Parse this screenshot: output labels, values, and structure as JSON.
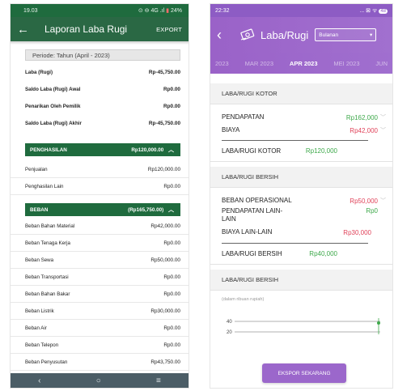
{
  "left": {
    "status_time": "19.03",
    "status_icons": "⊙ ⊖ 4G .ıl",
    "status_battery": "24%",
    "title": "Laporan Laba Rugi",
    "export_label": "EXPORT",
    "period": "Periode: Tahun (April - 2023)",
    "summary": [
      {
        "label": "Laba (Rugi)",
        "value": "Rp-45,750.00"
      },
      {
        "label": "Saldo Laba (Rugi) Awal",
        "value": "Rp0.00"
      },
      {
        "label": "Penarikan Oleh Pemilik",
        "value": "Rp0.00"
      },
      {
        "label": "Saldo Laba (Rugi) Akhir",
        "value": "Rp-45,750.00"
      }
    ],
    "income": {
      "label": "PENGHASILAN",
      "total": "Rp120,000.00",
      "items": [
        {
          "label": "Penjualan",
          "value": "Rp120,000.00"
        },
        {
          "label": "Penghasilan Lain",
          "value": "Rp0.00"
        }
      ]
    },
    "expense": {
      "label": "BEBAN",
      "total": "(Rp165,750.00)",
      "items": [
        {
          "label": "Beban Bahan Material",
          "value": "Rp42,000.00"
        },
        {
          "label": "Beban Tenaga Kerja",
          "value": "Rp0.00"
        },
        {
          "label": "Beban Sewa",
          "value": "Rp50,000.00"
        },
        {
          "label": "Beban Transportasi",
          "value": "Rp0.00"
        },
        {
          "label": "Beban Bahan Bakar",
          "value": "Rp0.00"
        },
        {
          "label": "Beban Listrik",
          "value": "Rp30,000.00"
        },
        {
          "label": "Beban Air",
          "value": "Rp0.00"
        },
        {
          "label": "Beban Telepon",
          "value": "Rp0.00"
        },
        {
          "label": "Beban Penyusutan",
          "value": "Rp43,750.00"
        }
      ]
    },
    "nav": {
      "back": "‹",
      "home": "○",
      "menu": "≡"
    },
    "icons": {
      "back": "arrow-left-icon",
      "chevron": "chevron-up-icon"
    },
    "colors": {
      "header": "#2a6844",
      "section": "#1f6b3e"
    }
  },
  "right": {
    "status_time": "22:32",
    "status_icons": "... ⊠ ᯤ",
    "status_battery": "48",
    "title": "Laba/Rugi",
    "select_value": "Bulanan",
    "tabs": [
      {
        "label": "2023",
        "active": false
      },
      {
        "label": "MAR 2023",
        "active": false
      },
      {
        "label": "APR 2023",
        "active": true
      },
      {
        "label": "MEI 2023",
        "active": false
      },
      {
        "label": "JUN",
        "active": false
      }
    ],
    "gross": {
      "header": "LABA/RUGI KOTOR",
      "income_label": "PENDAPATAN",
      "income_value": "Rp162,000",
      "cost_label": "BIAYA",
      "cost_value": "Rp42,000",
      "total_label": "LABA/RUGI KOTOR",
      "total_value": "Rp120,000"
    },
    "net": {
      "header": "LABA/RUGI BERSIH",
      "op_label": "BEBAN OPERASIONAL",
      "op_value": "Rp50,000",
      "other_income_label": "PENDAPATAN LAIN-LAIN",
      "other_income_value": "Rp0",
      "other_cost_label": "BIAYA LAIN-LAIN",
      "other_cost_value": "Rp30,000",
      "total_label": "LABA/RUGI BERSIH",
      "total_value": "Rp40,000"
    },
    "chart_section_header": "LABA/RUGI BERSIH",
    "chart_note": "(dalam ribuan rupiah)",
    "chart_ticks": [
      "40",
      "20"
    ],
    "export_button": "EKSPOR SEKARANG",
    "colors": {
      "accent": "#9b67cb",
      "positive": "#3ea94b",
      "negative": "#e0435a"
    }
  }
}
